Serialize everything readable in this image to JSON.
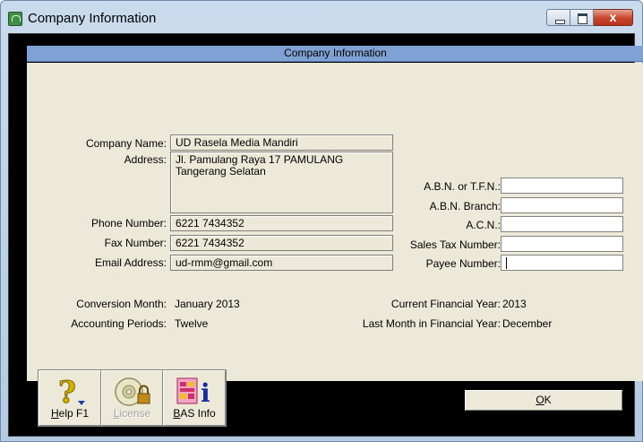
{
  "window": {
    "title": "Company Information",
    "close_glyph": "x"
  },
  "header": {
    "title": "Company Information"
  },
  "company": {
    "name_label": "Company Name:",
    "name": "UD Rasela Media Mandiri",
    "address_label": "Address:",
    "address_line1": "Jl. Pamulang Raya 17 PAMULANG",
    "address_line2": "Tangerang Selatan",
    "phone_label": "Phone Number:",
    "phone": "6221 7434352",
    "fax_label": "Fax Number:",
    "fax": "6221 7434352",
    "email_label": "Email Address:",
    "email": "ud-rmm@gmail.com"
  },
  "tax": {
    "abn_label": "A.B.N. or T.F.N.:",
    "abn": "",
    "branch_label": "A.B.N. Branch:",
    "branch": "",
    "acn_label": "A.C.N.:",
    "acn": "",
    "sales_tax_label": "Sales Tax Number:",
    "sales_tax": "",
    "payee_label": "Payee Number:",
    "payee": ""
  },
  "period": {
    "conversion_label": "Conversion Month:",
    "conversion": "January 2013",
    "accounting_label": "Accounting Periods:",
    "accounting": "Twelve",
    "fy_label": "Current Financial Year:",
    "fy": "2013",
    "last_month_label": "Last Month in Financial Year:",
    "last_month": "December"
  },
  "toolbar": {
    "help_icon": "question-mark-icon",
    "help_key": "H",
    "help_rest": "elp F1",
    "license_icon": "cd-lock-icon",
    "license_key": "L",
    "license_rest": "icense",
    "bas_icon": "bas-info-icon",
    "bas_key": "B",
    "bas_rest": "AS Info",
    "bas_glyph": "i"
  },
  "ok": {
    "key": "O",
    "rest": "K"
  },
  "colors": {
    "header_bar": "#7fa1d3",
    "panel": "#ece9d8",
    "close_button": "#c7432a"
  }
}
